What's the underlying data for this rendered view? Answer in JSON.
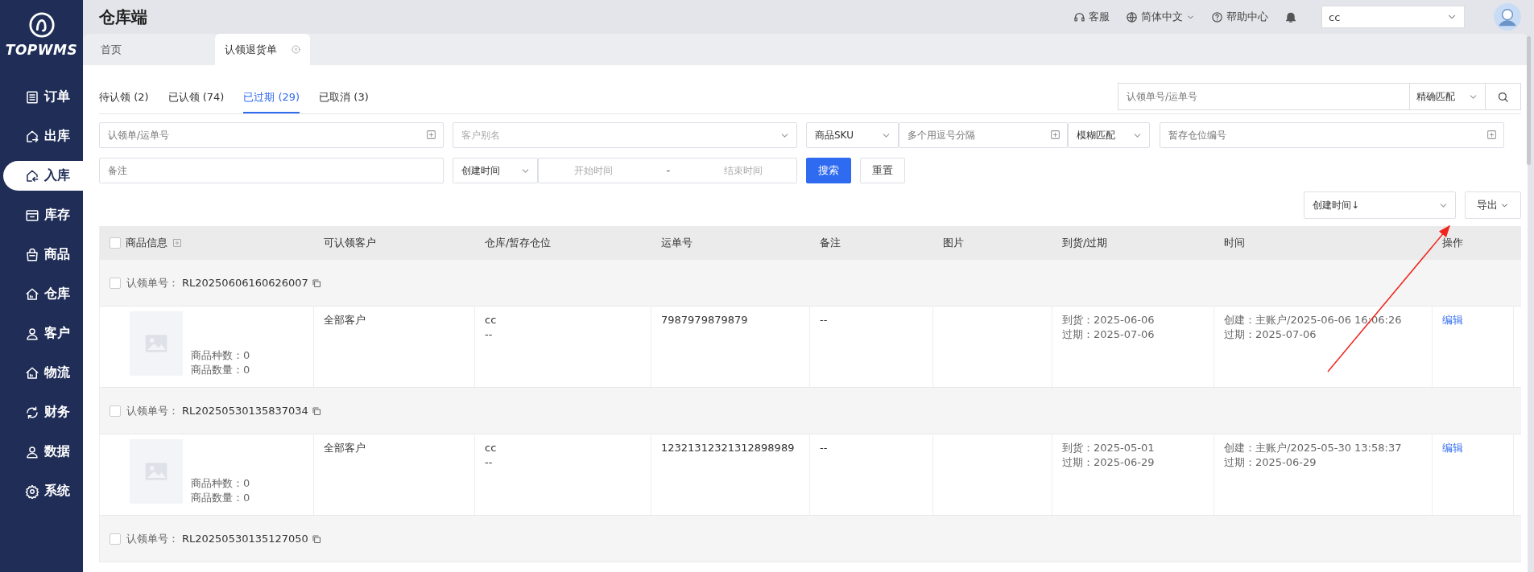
{
  "sidebar": {
    "logo": "TOPWMS",
    "items": [
      {
        "label": "订单",
        "selected": false
      },
      {
        "label": "出库",
        "selected": false
      },
      {
        "label": "入库",
        "selected": true
      },
      {
        "label": "库存",
        "selected": false
      },
      {
        "label": "商品",
        "selected": false
      },
      {
        "label": "仓库",
        "selected": false
      },
      {
        "label": "客户",
        "selected": false
      },
      {
        "label": "物流",
        "selected": false
      },
      {
        "label": "财务",
        "selected": false
      },
      {
        "label": "数据",
        "selected": false
      },
      {
        "label": "系统",
        "selected": false
      }
    ]
  },
  "header": {
    "title": "仓库端",
    "links": [
      {
        "kind": "support",
        "label": "客服"
      },
      {
        "kind": "language",
        "label": "简体中文"
      },
      {
        "kind": "help",
        "label": "帮助中心"
      },
      {
        "kind": "bell"
      }
    ],
    "account_select": {
      "value": "cc"
    }
  },
  "page_tabs": [
    {
      "label": "首页",
      "selected": false
    },
    {
      "label": "认领退货单",
      "selected": true
    }
  ],
  "status_tabs": [
    {
      "label": "待认领 (2)",
      "selected": false
    },
    {
      "label": "已认领 (74)",
      "selected": false
    },
    {
      "label": "已过期 (29)",
      "selected": true
    },
    {
      "label": "已取消 (3)",
      "selected": false
    }
  ],
  "quick_search": {
    "placeholder": "认领单号/运单号",
    "match": "精确匹配"
  },
  "filter_rows": [
    [
      {
        "kind": "picker",
        "placeholder": "认领单/运单号"
      },
      {
        "kind": "select",
        "placeholder": "客户别名"
      },
      {
        "kind": "select",
        "value": "商品SKU"
      },
      {
        "kind": "picker",
        "placeholder": "多个用逗号分隔"
      },
      {
        "kind": "select",
        "value": "模糊匹配"
      },
      {
        "kind": "picker",
        "placeholder": "暂存仓位编号"
      }
    ],
    [
      {
        "kind": "input",
        "placeholder": "备注"
      },
      {
        "kind": "select",
        "value": "创建时间"
      },
      {
        "kind": "daterange",
        "start": "开始时间",
        "sep": "-",
        "end": "结束时间"
      },
      {
        "kind": "primary",
        "label": "搜索"
      },
      {
        "kind": "button",
        "label": "重置"
      }
    ]
  ],
  "sort_select": {
    "value": "创建时间↓"
  },
  "export_button": {
    "label": "导出"
  },
  "table": {
    "columns": [
      {
        "label": "商品信息",
        "checked": false
      },
      {
        "label": "可认领客户"
      },
      {
        "label": "仓库/暂存仓位"
      },
      {
        "label": "运单号"
      },
      {
        "label": "备注"
      },
      {
        "label": "图片"
      },
      {
        "label": "到货/过期"
      },
      {
        "label": "时间"
      },
      {
        "label": "操作"
      }
    ],
    "groups": [
      {
        "checked": false,
        "order_label": "认领单号：",
        "order_no": "RL20250606160626007",
        "items": [
          {
            "kinds": "商品种数：0",
            "quantity": "商品数量：0",
            "customer": "全部客户",
            "warehouse": "cc",
            "location": "--",
            "tracking": "7987979879879",
            "remark": "--",
            "arrival": "到货：2025-06-06",
            "expiry": "过期：2025-07-06",
            "created": "创建：主账户/2025-06-06 16:06:26",
            "expired": "过期：2025-07-06",
            "action": "编辑"
          }
        ]
      },
      {
        "checked": false,
        "order_label": "认领单号：",
        "order_no": "RL20250530135837034",
        "items": [
          {
            "kinds": "商品种数：0",
            "quantity": "商品数量：0",
            "customer": "全部客户",
            "warehouse": "cc",
            "location": "--",
            "tracking": "12321312321312898989",
            "remark": "--",
            "arrival": "到货：2025-05-01",
            "expiry": "过期：2025-06-29",
            "created": "创建：主账户/2025-05-30 13:58:37",
            "expired": "过期：2025-06-29",
            "action": "编辑"
          }
        ]
      },
      {
        "checked": false,
        "order_label": "认领单号：",
        "order_no": "RL20250530135127050"
      }
    ]
  },
  "annotations": [
    {
      "kind": "arrow"
    }
  ]
}
